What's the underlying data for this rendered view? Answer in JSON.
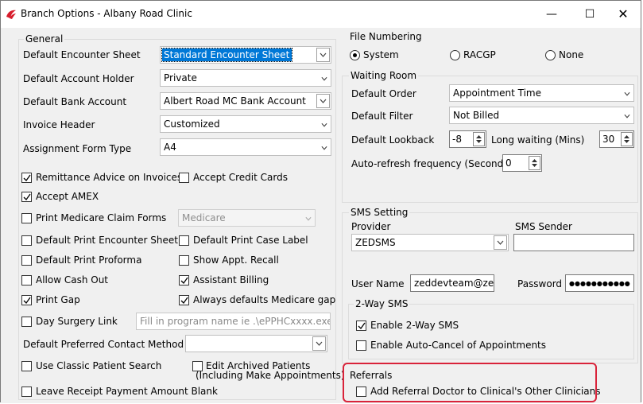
{
  "window": {
    "title": "Branch Options - Albany Road Clinic",
    "minimize": "—",
    "maximize": "☐",
    "close": "✕"
  },
  "general": {
    "label": "General",
    "default_encounter_sheet": {
      "label": "Default Encounter Sheet",
      "value": "Standard Encounter Sheet"
    },
    "default_account_holder": {
      "label": "Default Account Holder",
      "value": "Private"
    },
    "default_bank_account": {
      "label": "Default Bank Account",
      "value": "Albert Road MC Bank Account"
    },
    "invoice_header": {
      "label": "Invoice Header",
      "value": "Customized"
    },
    "assignment_form_type": {
      "label": "Assignment Form Type",
      "value": "A4"
    },
    "checkboxes": {
      "remittance_advice": {
        "label": "Remittance Advice on Invoices",
        "checked": true
      },
      "accept_credit_cards": {
        "label": "Accept Credit Cards",
        "checked": false
      },
      "accept_amex": {
        "label": "Accept AMEX",
        "checked": true
      },
      "print_medicare_claim_forms": {
        "label": "Print Medicare Claim Forms",
        "checked": false
      },
      "default_print_encounter_sheet": {
        "label": "Default Print Encounter Sheet",
        "checked": false
      },
      "default_print_case_label": {
        "label": "Default Print Case Label",
        "checked": false
      },
      "default_print_proforma": {
        "label": "Default Print Proforma",
        "checked": false
      },
      "show_appt_recall": {
        "label": "Show Appt. Recall",
        "checked": false
      },
      "allow_cash_out": {
        "label": "Allow Cash Out",
        "checked": false
      },
      "assistant_billing": {
        "label": "Assistant Billing",
        "checked": true
      },
      "print_gap": {
        "label": "Print Gap",
        "checked": true
      },
      "always_defaults_medicare_gap": {
        "label": "Always defaults Medicare gap",
        "checked": true
      },
      "day_surgery_link": {
        "label": "Day Surgery Link",
        "checked": false
      },
      "use_classic_patient_search": {
        "label": "Use Classic Patient Search",
        "checked": false
      },
      "edit_archived_patients": {
        "label": "Edit Archived Patients",
        "label2": "(Including Make Appointments)",
        "checked": false
      },
      "leave_receipt_payment_blank": {
        "label": "Leave Receipt Payment Amount Blank",
        "checked": false
      }
    },
    "medicare_select": "Medicare",
    "day_surgery_placeholder": "Fill in program name ie .\\ePPHCxxxx.exe",
    "default_preferred_contact": {
      "label": "Default Preferred Contact Method",
      "value": ""
    }
  },
  "file_numbering": {
    "label": "File Numbering",
    "options": [
      {
        "label": "System",
        "selected": true
      },
      {
        "label": "RACGP",
        "selected": false
      },
      {
        "label": "None",
        "selected": false
      }
    ]
  },
  "waiting_room": {
    "label": "Waiting Room",
    "default_order": {
      "label": "Default Order",
      "value": "Appointment Time"
    },
    "default_filter": {
      "label": "Default Filter",
      "value": "Not Billed"
    },
    "default_lookback": {
      "label": "Default Lookback",
      "value": "-8"
    },
    "long_waiting": {
      "label": "Long waiting (Mins)",
      "value": "30"
    },
    "auto_refresh": {
      "label": "Auto-refresh frequency (Seconds)",
      "value": "0"
    }
  },
  "sms": {
    "label": "SMS Setting",
    "provider_label": "Provider",
    "provider_value": "ZEDSMS",
    "sender_label": "SMS Sender",
    "sender_value": "",
    "username_label": "User Name",
    "username_value": "zeddevteam@zed",
    "password_label": "Password",
    "password_value": "●●●●●●●●●●●",
    "two_way": {
      "label": "2-Way SMS",
      "enable": {
        "label": "Enable 2-Way SMS",
        "checked": true
      },
      "auto_cancel": {
        "label": "Enable Auto-Cancel of Appointments",
        "checked": false
      }
    }
  },
  "referrals": {
    "label": "Referrals",
    "add_referral_doctor": {
      "label": "Add Referral Doctor to Clinical's Other Clinicians",
      "checked": false
    }
  },
  "colors": {
    "accent": "#0078d7",
    "highlight_box": "#d9233a",
    "app_icon": "#d71c2c"
  }
}
